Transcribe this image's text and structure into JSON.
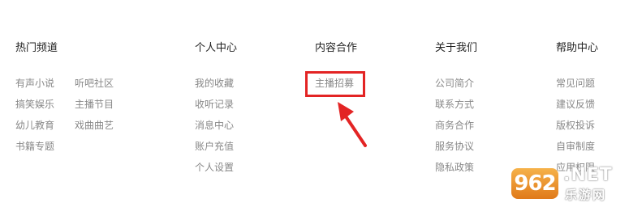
{
  "columns": {
    "hot": {
      "title": "热门频道",
      "links_a": [
        "有声小说",
        "搞笑娱乐",
        "幼儿教育",
        "书籍专题"
      ],
      "links_b": [
        "听吧社区",
        "主播节目",
        "戏曲曲艺"
      ]
    },
    "personal": {
      "title": "个人中心",
      "links": [
        "我的收藏",
        "收听记录",
        "消息中心",
        "账户充值",
        "个人设置"
      ]
    },
    "content": {
      "title": "内容合作",
      "links": [
        "主播招募"
      ]
    },
    "about": {
      "title": "关于我们",
      "links": [
        "公司简介",
        "联系方式",
        "商务合作",
        "服务协议",
        "隐私政策"
      ]
    },
    "help": {
      "title": "帮助中心",
      "links": [
        "常见问题",
        "建议反馈",
        "版权投诉",
        "自审制度",
        "应用权限"
      ]
    }
  },
  "annotation": {
    "color": "#e32424"
  },
  "watermark": {
    "badge": "962",
    "net": ".NET",
    "sub": "乐游网"
  }
}
